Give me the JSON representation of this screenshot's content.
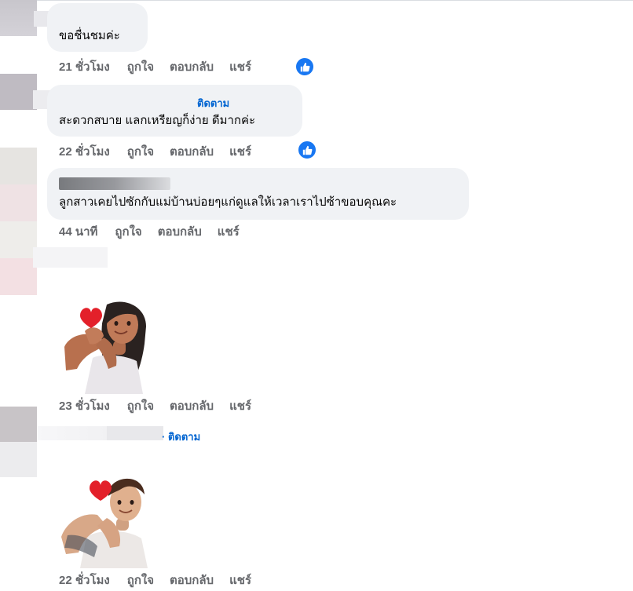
{
  "comments": [
    {
      "text": "ขอชื่นชมค่ะ",
      "time": "21 ชั่วโมง",
      "like_label": "ถูกใจ",
      "reply_label": "ตอบกลับ",
      "share_label": "แชร์"
    },
    {
      "follow_label": "ติดตาม",
      "text": "สะดวกสบาย แลกเหรียญก็ง่าย ดีมากค่ะ",
      "time": "22 ชั่วโมง",
      "like_label": "ถูกใจ",
      "reply_label": "ตอบกลับ",
      "share_label": "แชร์"
    },
    {
      "text": "ลูกสาวเคยไปซักกับแม่บ้านบ่อยๆแก่ดูแลให้เวลาเราไปซ้าขอบคุณคะ",
      "time": "44 นาที",
      "like_label": "ถูกใจ",
      "reply_label": "ตอบกลับ",
      "share_label": "แชร์"
    },
    {
      "sticker": "heart-hands-woman-sticker",
      "time": "23 ชั่วโมง",
      "like_label": "ถูกใจ",
      "reply_label": "ตอบกลับ",
      "share_label": "แชร์"
    },
    {
      "follow_label": "· ติดตาม",
      "sticker": "heart-hands-man-sticker",
      "time": "22 ชั่วโมง",
      "like_label": "ถูกใจ",
      "reply_label": "ตอบกลับ",
      "share_label": "แชร์"
    }
  ],
  "colors": {
    "bubble": "#f0f2f5",
    "link": "#0064d1",
    "meta": "#65676b",
    "like_badge": "#1877f2"
  },
  "icons": {
    "reaction": "thumbs-up-icon"
  }
}
